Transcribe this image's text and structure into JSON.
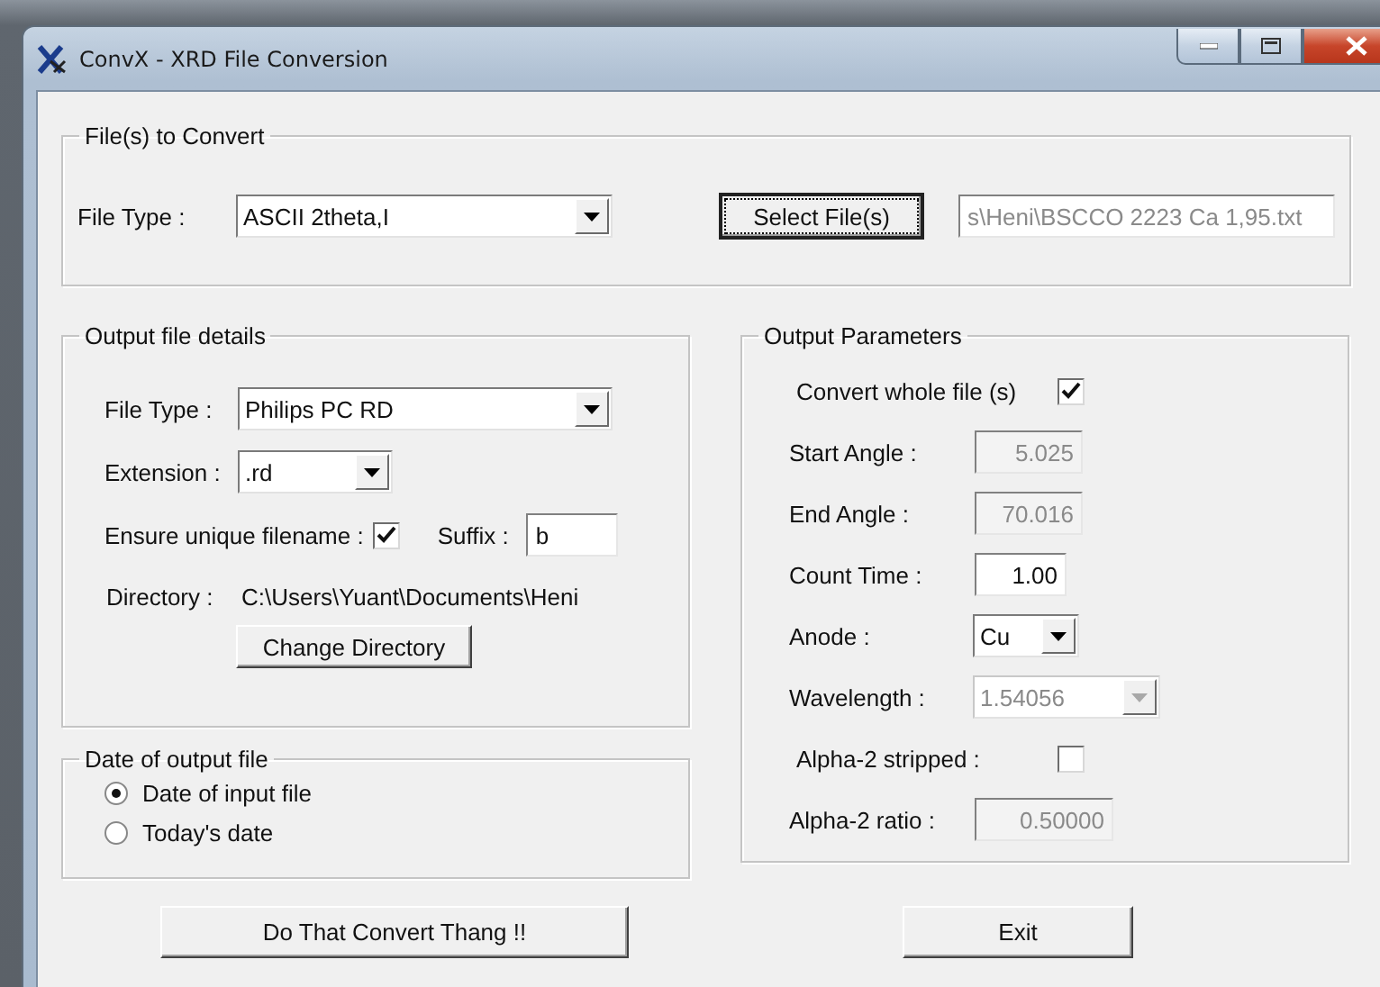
{
  "window": {
    "title": "ConvX - XRD File Conversion"
  },
  "files_group": {
    "title": "File(s) to Convert",
    "file_type_label": "File Type :",
    "file_type_value": "ASCII 2theta,I",
    "select_button": "Select File(s)",
    "path_value": "s\\Heni\\BSCCO 2223 Ca 1,95.txt"
  },
  "output_group": {
    "title": "Output file details",
    "file_type_label": "File Type :",
    "file_type_value": "Philips PC RD",
    "extension_label": "Extension :",
    "extension_value": ".rd",
    "unique_label": "Ensure unique filename :",
    "unique_checked": true,
    "suffix_label": "Suffix :",
    "suffix_value": "b",
    "directory_label": "Directory :",
    "directory_value": "C:\\Users\\Yuant\\Documents\\Heni",
    "change_button": "Change Directory"
  },
  "date_group": {
    "title": "Date of output file",
    "options": [
      {
        "label": "Date of input file",
        "selected": true
      },
      {
        "label": "Today's date",
        "selected": false
      }
    ]
  },
  "params_group": {
    "title": "Output Parameters",
    "rows": [
      {
        "kind": "checkbox",
        "label": "Convert whole file (s)",
        "checked": true
      },
      {
        "kind": "field",
        "label": "Start Angle :",
        "value": "5.025",
        "disabled": true
      },
      {
        "kind": "field",
        "label": "End Angle :",
        "value": "70.016",
        "disabled": true
      },
      {
        "kind": "field",
        "label": "Count  Time :",
        "value": "1.00",
        "disabled": false
      },
      {
        "kind": "dropdown",
        "label": "Anode :",
        "value": "Cu",
        "disabled": false
      },
      {
        "kind": "dropdown",
        "label": "Wavelength :",
        "value": "1.54056",
        "disabled": true
      },
      {
        "kind": "checkbox",
        "label": "Alpha-2 stripped :",
        "checked": false
      },
      {
        "kind": "field",
        "label": "Alpha-2 ratio :",
        "value": "0.50000",
        "disabled": true
      }
    ]
  },
  "buttons": [
    {
      "kind": "convert",
      "label": "Do That Convert Thang !!"
    },
    {
      "kind": "exit",
      "label": "Exit"
    }
  ]
}
